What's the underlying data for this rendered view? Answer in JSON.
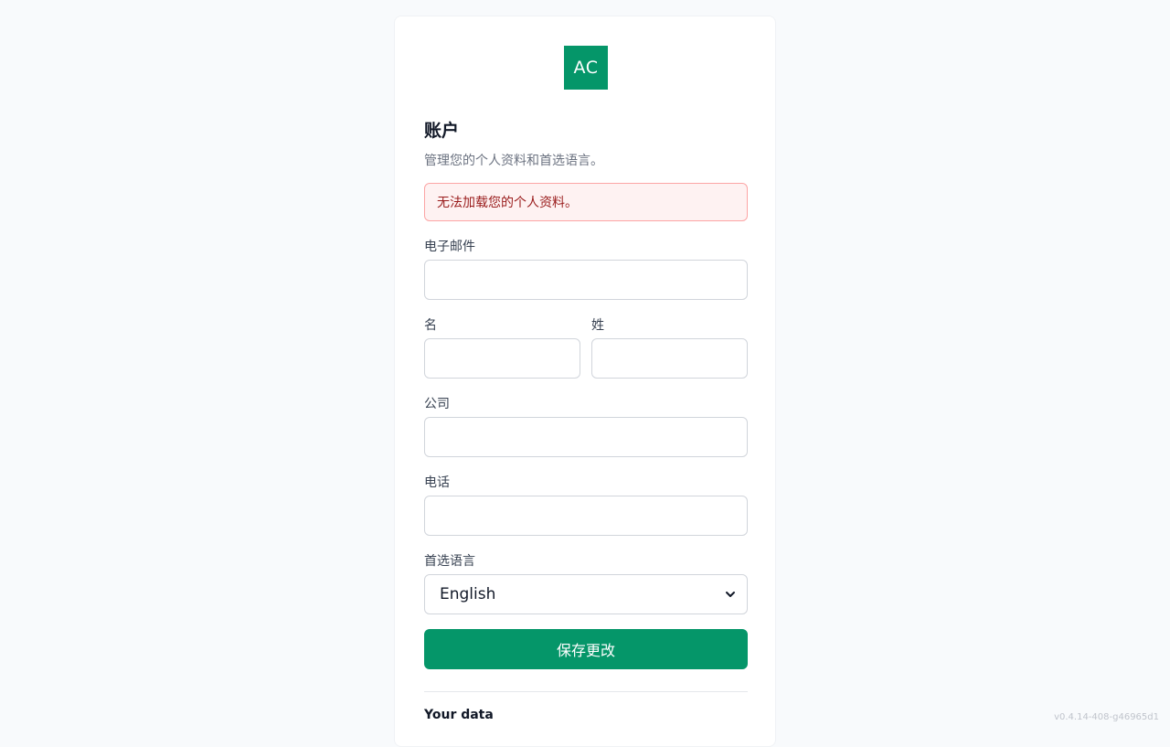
{
  "logo": {
    "text": "AC",
    "color": "#059669"
  },
  "page": {
    "title": "账户",
    "subtitle": "管理您的个人资料和首选语言。"
  },
  "alert": {
    "message": "无法加载您的个人资料。"
  },
  "form": {
    "email": {
      "label": "电子邮件",
      "value": "",
      "placeholder": ""
    },
    "first_name": {
      "label": "名",
      "value": "",
      "placeholder": ""
    },
    "last_name": {
      "label": "姓",
      "value": "",
      "placeholder": ""
    },
    "company": {
      "label": "公司",
      "value": "",
      "placeholder": ""
    },
    "phone": {
      "label": "电话",
      "value": "",
      "placeholder": ""
    },
    "language": {
      "label": "首选语言",
      "selected": "English"
    },
    "save_label": "保存更改"
  },
  "data_section": {
    "title": "Your data"
  },
  "footer": {
    "version": "v0.4.14-408-g46965d1"
  },
  "colors": {
    "accent": "#059669",
    "alert_bg": "#fef2f2",
    "alert_border": "#fca5a5",
    "alert_text": "#991b1b"
  }
}
